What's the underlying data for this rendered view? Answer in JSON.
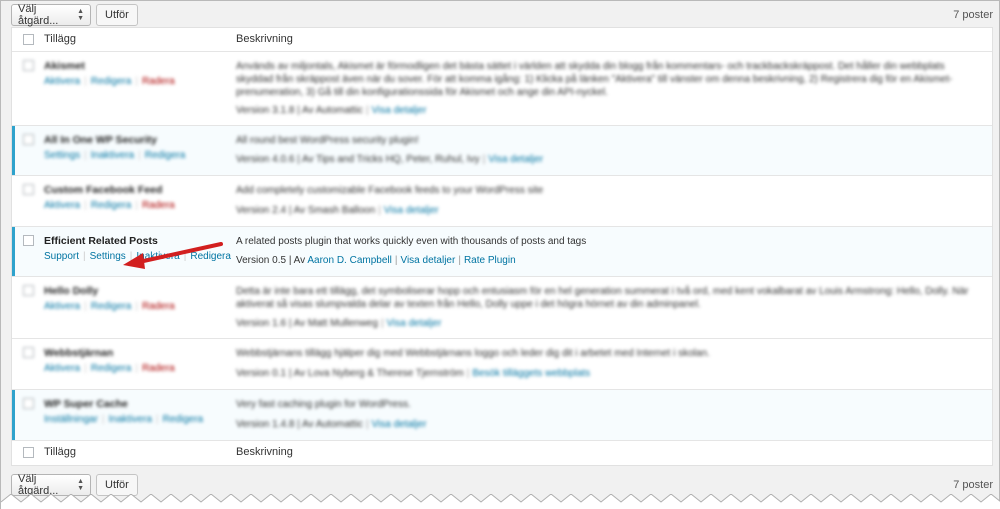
{
  "bulk_select": "Välj åtgärd...",
  "apply_label": "Utför",
  "count_label": "7 poster",
  "headers": {
    "plugin": "Tillägg",
    "description": "Beskrivning"
  },
  "plugins": [
    {
      "name": "Akismet",
      "actions": [
        "Aktivera",
        "Redigera",
        "Radera"
      ],
      "description": "Används av miljontals, Akismet är förmodligen det bästa sättet i världen att skydda din blogg från kommentars- och trackbackskräppost. Det håller din webbplats skyddad från skräppost även när du sover. För att komma igång: 1) Klicka på länken \"Aktivera\" till vänster om denna beskrivning, 2) Registrera dig för en Akismet-prenumeration, 3) Gå till din konfigurationssida för Akismet och ange din API-nyckel.",
      "meta": [
        "Version 3.1.8 | Av Automattic",
        "Visa detaljer"
      ]
    },
    {
      "name": "All In One WP Security",
      "actions": [
        "Settings",
        "Inaktivera",
        "Redigera"
      ],
      "description": "All round best WordPress security plugin!",
      "meta": [
        "Version 4.0.6 | Av Tips and Tricks HQ, Peter, Ruhul, Ivy",
        "Visa detaljer"
      ]
    },
    {
      "name": "Custom Facebook Feed",
      "actions": [
        "Aktivera",
        "Redigera",
        "Radera"
      ],
      "description": "Add completely customizable Facebook feeds to your WordPress site",
      "meta": [
        "Version 2.4 | Av Smash Balloon",
        "Visa detaljer"
      ]
    },
    {
      "name": "Efficient Related Posts",
      "actions": [
        "Support",
        "Settings",
        "Inaktivera",
        "Redigera"
      ],
      "description": "A related posts plugin that works quickly even with thousands of posts and tags",
      "meta": [
        "Version 0.5 | Av",
        "Aaron D. Campbell",
        "Visa detaljer",
        "Rate Plugin"
      ]
    },
    {
      "name": "Hello Dolly",
      "actions": [
        "Aktivera",
        "Redigera",
        "Radera"
      ],
      "description": "Detta är inte bara ett tillägg, det symboliserar hopp och entusiasm för en hel generation summerat i två ord, med kent vokalbarat av Louis Armstrong: Hello, Dolly. När aktiverat så visas slumpvalda delar av texten från Hello, Dolly uppe i det högra hörnet av din adminpanel.",
      "meta": [
        "Version 1.6 | Av Matt Mullenweg",
        "Visa detaljer"
      ]
    },
    {
      "name": "Webbstjärnan",
      "actions": [
        "Aktivera",
        "Redigera",
        "Radera"
      ],
      "description": "Webbstjärnans tillägg hjälper dig med Webbstjärnans loggo och leder dig dit i arbetet med Internet i skolan.",
      "meta": [
        "Version 0.1 | Av Lova Nyberg & Therese Tjernström",
        "Besök tilläggets webbplats"
      ]
    },
    {
      "name": "WP Super Cache",
      "actions": [
        "Inställningar",
        "Inaktivera",
        "Redigera"
      ],
      "description": "Very fast caching plugin for WordPress.",
      "meta": [
        "Version 1.4.8 | Av Automattic",
        "Visa detaljer"
      ]
    }
  ]
}
